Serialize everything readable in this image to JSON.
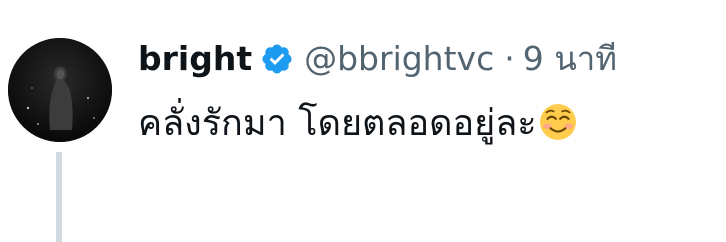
{
  "tweet": {
    "avatar_icon": "user-avatar-photo",
    "display_name": "bright",
    "verified_icon": "verified-badge-icon",
    "verified_color": "#1d9bf0",
    "handle": "@bbrightvc",
    "separator": "·",
    "time": "9 นาที",
    "text": "คลั่งรักมา โดยตลอดอยู่ละ",
    "emoji_icon": "smiling-face-emoji",
    "text_color": "#0f1419",
    "muted_color": "#536471",
    "thread_line_color": "#cfd9de"
  }
}
